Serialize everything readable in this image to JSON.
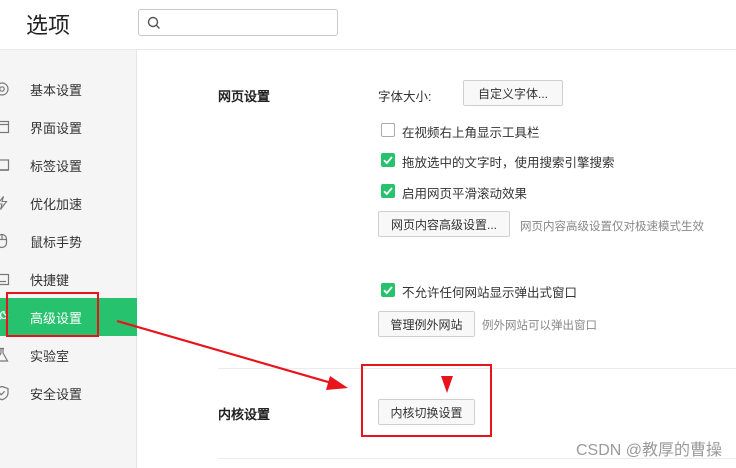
{
  "header": {
    "title": "选项",
    "search_placeholder": ""
  },
  "sidebar": {
    "items": [
      {
        "label": "基本设置",
        "icon": "gear-icon",
        "active": false
      },
      {
        "label": "界面设置",
        "icon": "window-icon",
        "active": false
      },
      {
        "label": "标签设置",
        "icon": "tab-icon",
        "active": false
      },
      {
        "label": "优化加速",
        "icon": "lightning-icon",
        "active": false
      },
      {
        "label": "鼠标手势",
        "icon": "mouse-icon",
        "active": false
      },
      {
        "label": "快捷键",
        "icon": "keyboard-icon",
        "active": false
      },
      {
        "label": "高级设置",
        "icon": "wrench-icon",
        "active": true
      },
      {
        "label": "实验室",
        "icon": "flask-icon",
        "active": false
      },
      {
        "label": "安全设置",
        "icon": "shield-icon",
        "active": false
      }
    ]
  },
  "webpage_section": {
    "label": "网页设置",
    "font_size_label": "字体大小:",
    "custom_font_button": "自定义字体...",
    "options": [
      {
        "label": "在视频右上角显示工具栏",
        "checked": false
      },
      {
        "label": "拖放选中的文字时，使用搜索引擎搜索",
        "checked": true
      },
      {
        "label": "启用网页平滑滚动效果",
        "checked": true
      }
    ],
    "advanced_button": "网页内容高级设置...",
    "advanced_hint": "网页内容高级设置仅对极速模式生效",
    "popup_option": {
      "label": "不允许任何网站显示弹出式窗口",
      "checked": true
    },
    "exceptions_button": "管理例外网站",
    "exceptions_hint": "例外网站可以弹出窗口"
  },
  "kernel_section": {
    "label": "内核设置",
    "switch_button": "内核切换设置"
  },
  "watermark": "CSDN @教厚的曹操",
  "colors": {
    "accent": "#27c26e",
    "annotation": "#e8141b"
  }
}
